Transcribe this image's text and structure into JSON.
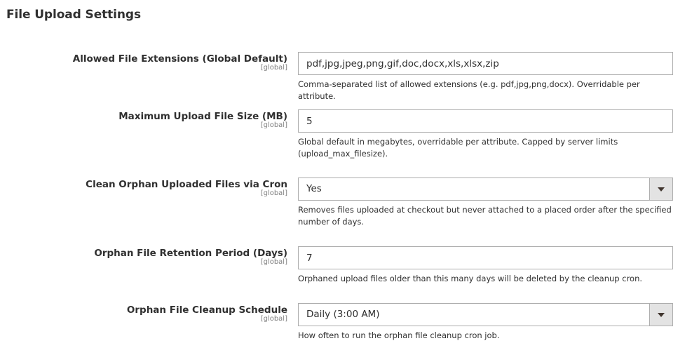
{
  "section": {
    "title": "File Upload Settings"
  },
  "fields": {
    "allowed_extensions": {
      "label": "Allowed File Extensions (Global Default)",
      "scope": "[global]",
      "value": "pdf,jpg,jpeg,png,gif,doc,docx,xls,xlsx,zip",
      "note": "Comma-separated list of allowed extensions (e.g. pdf,jpg,png,docx). Overridable per attribute."
    },
    "max_file_size": {
      "label": "Maximum Upload File Size (MB)",
      "scope": "[global]",
      "value": "5",
      "note": "Global default in megabytes, overridable per attribute. Capped by server limits (upload_max_filesize)."
    },
    "clean_orphan": {
      "label": "Clean Orphan Uploaded Files via Cron",
      "scope": "[global]",
      "selected": "Yes",
      "note": "Removes files uploaded at checkout but never attached to a placed order after the specified number of days."
    },
    "retention_period": {
      "label": "Orphan File Retention Period (Days)",
      "scope": "[global]",
      "value": "7",
      "note": "Orphaned upload files older than this many days will be deleted by the cleanup cron."
    },
    "cleanup_schedule": {
      "label": "Orphan File Cleanup Schedule",
      "scope": "[global]",
      "selected": "Daily (3:00 AM)",
      "note": "How often to run the orphan file cleanup cron job."
    }
  },
  "icons": {
    "select_caret": "chevron-down-icon"
  }
}
